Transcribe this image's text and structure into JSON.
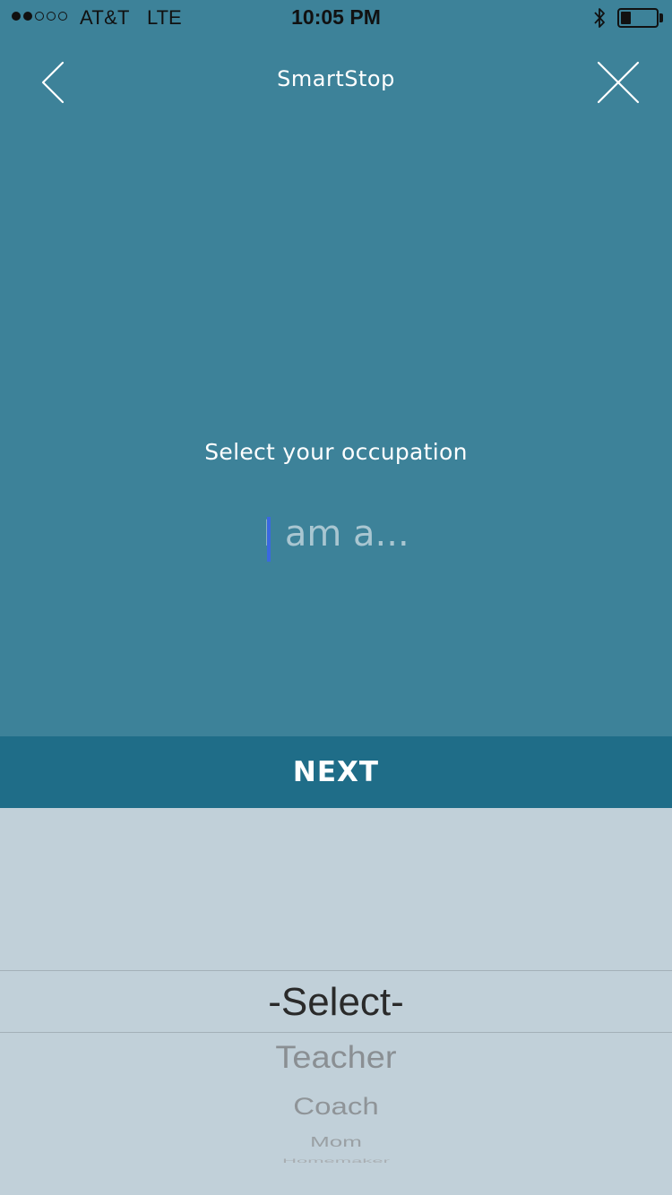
{
  "status_bar": {
    "carrier": "AT&T",
    "network": "LTE",
    "time": "10:05 PM",
    "signal_bars_filled": 2,
    "signal_bars_total": 5,
    "battery_level": 0.3
  },
  "nav": {
    "title": "SmartStop",
    "back_icon": "chevron-left-icon",
    "close_icon": "close-icon"
  },
  "form": {
    "prompt": "Select your occupation",
    "input_placeholder": "I am a...",
    "input_value": ""
  },
  "next_button": {
    "label": "NEXT"
  },
  "picker": {
    "selected": "-Select-",
    "options": [
      "Teacher",
      "Coach",
      "Mom",
      "Homemaker"
    ]
  },
  "colors": {
    "background": "#3d8299",
    "next_button": "#1f6d88",
    "picker_background": "#c1d0d9",
    "caret": "#3a68e0"
  }
}
